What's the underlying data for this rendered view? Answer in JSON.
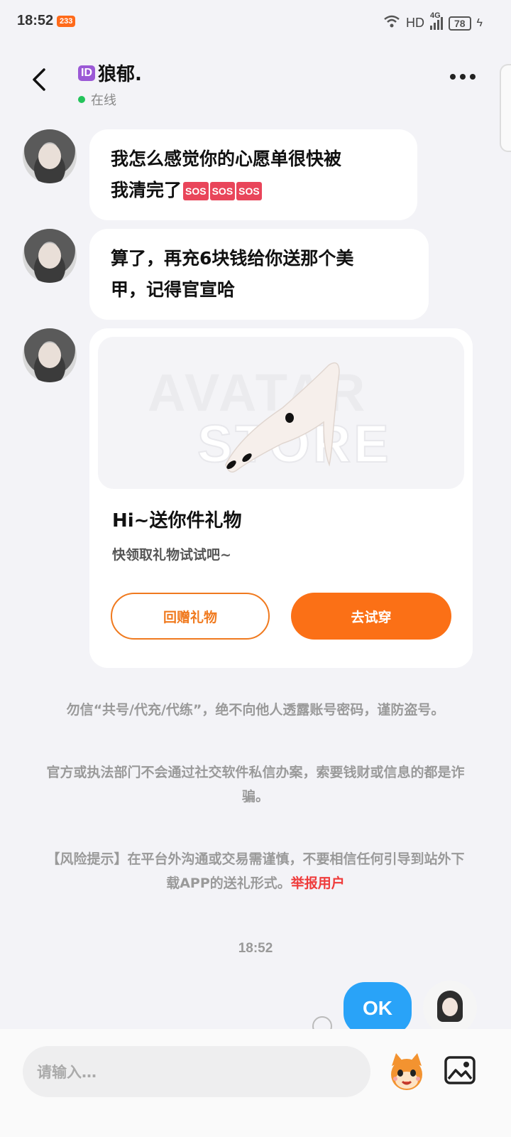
{
  "status_bar": {
    "time": "18:52",
    "app_badge": "233",
    "network": "HD",
    "signal": "4G",
    "battery": "78"
  },
  "header": {
    "id_badge": "ID",
    "name": "狼郁.",
    "status": "在线"
  },
  "messages": [
    {
      "side": "left",
      "text_line1": "我怎么感觉你的心愿单很快被",
      "text_line2": "我清完了",
      "emoji": [
        "SOS",
        "SOS",
        "SOS"
      ]
    },
    {
      "side": "left",
      "text_line1": "算了，再充6块钱给你送那个美",
      "text_line2": "甲，记得官宣哈"
    }
  ],
  "gift_card": {
    "watermark_line1": "AVATAR",
    "watermark_line2": "STORE",
    "title": "Hi~送你件礼物",
    "subtitle": "快领取礼物试试吧~",
    "return_gift_label": "回赠礼物",
    "try_on_label": "去试穿"
  },
  "notices": {
    "notice1": "勿信“共号/代充/代练”，绝不向他人透露账号密码，谨防盗号。",
    "notice2": "官方或执法部门不会通过社交软件私信办案，索要钱财或信息的都是诈骗。",
    "notice3": "【风险提示】在平台外沟通或交易需谨慎，不要相信任何引导到站外下载APP的送礼形式。",
    "report_link": "举报用户"
  },
  "timestamp": "18:52",
  "my_message": {
    "text": "OK"
  },
  "input": {
    "placeholder": "请输入…"
  },
  "colors": {
    "accent_orange": "#fb7016",
    "my_bubble_blue": "#29a3f8",
    "report_red": "#ef3b3b",
    "online_green": "#23c35a"
  }
}
